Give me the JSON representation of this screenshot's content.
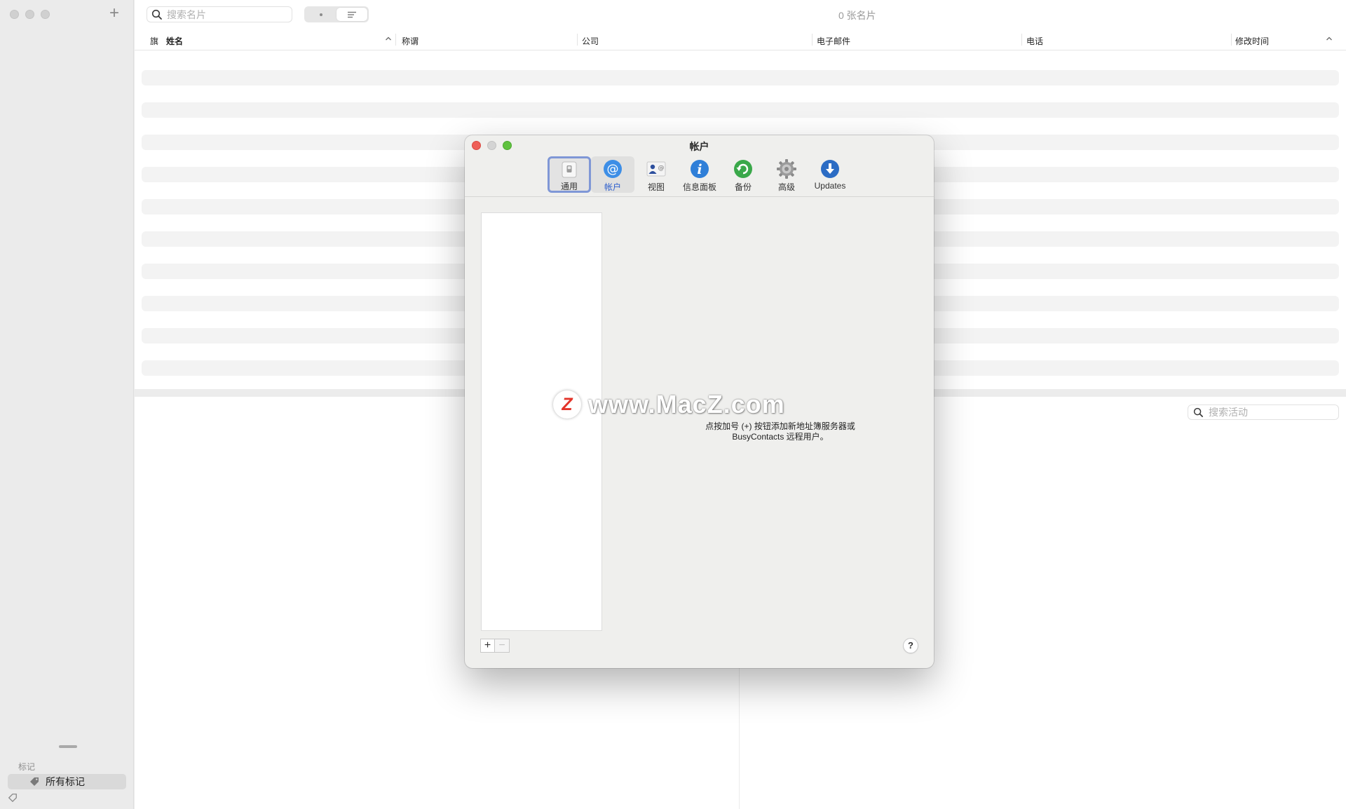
{
  "sidebar": {
    "add_label": "+",
    "tags_header": "标记",
    "tags_item": "所有标记"
  },
  "main": {
    "search_placeholder": "搜索名片",
    "card_count": "0 张名片",
    "columns": [
      "旗",
      "姓名",
      "称谓",
      "公司",
      "电子邮件",
      "电话",
      "修改时间"
    ]
  },
  "activity": {
    "search_placeholder": "搜索活动"
  },
  "dialog": {
    "title": "帐户",
    "toolbar": [
      {
        "label": "通用",
        "icon": "switch-icon"
      },
      {
        "label": "帐户",
        "icon": "at-icon"
      },
      {
        "label": "视图",
        "icon": "contact-view-icon"
      },
      {
        "label": "信息面板",
        "icon": "info-icon"
      },
      {
        "label": "备份",
        "icon": "backup-icon"
      },
      {
        "label": "高级",
        "icon": "gear-icon"
      },
      {
        "label": "Updates",
        "icon": "download-icon"
      }
    ],
    "hint_line1": "点按加号 (+) 按钮添加新地址簿服务器或",
    "hint_line2": "BusyContacts 远程用户。",
    "add_button": "+",
    "remove_button": "−",
    "help_button": "?"
  },
  "watermark": {
    "logo_letter": "Z",
    "text": "www.MacZ.com"
  },
  "colors": {
    "accent_blue": "#2a5ccc",
    "focus_ring": "#7f97d6",
    "close_red": "#ee5f58",
    "zoom_green": "#5fc23f"
  }
}
